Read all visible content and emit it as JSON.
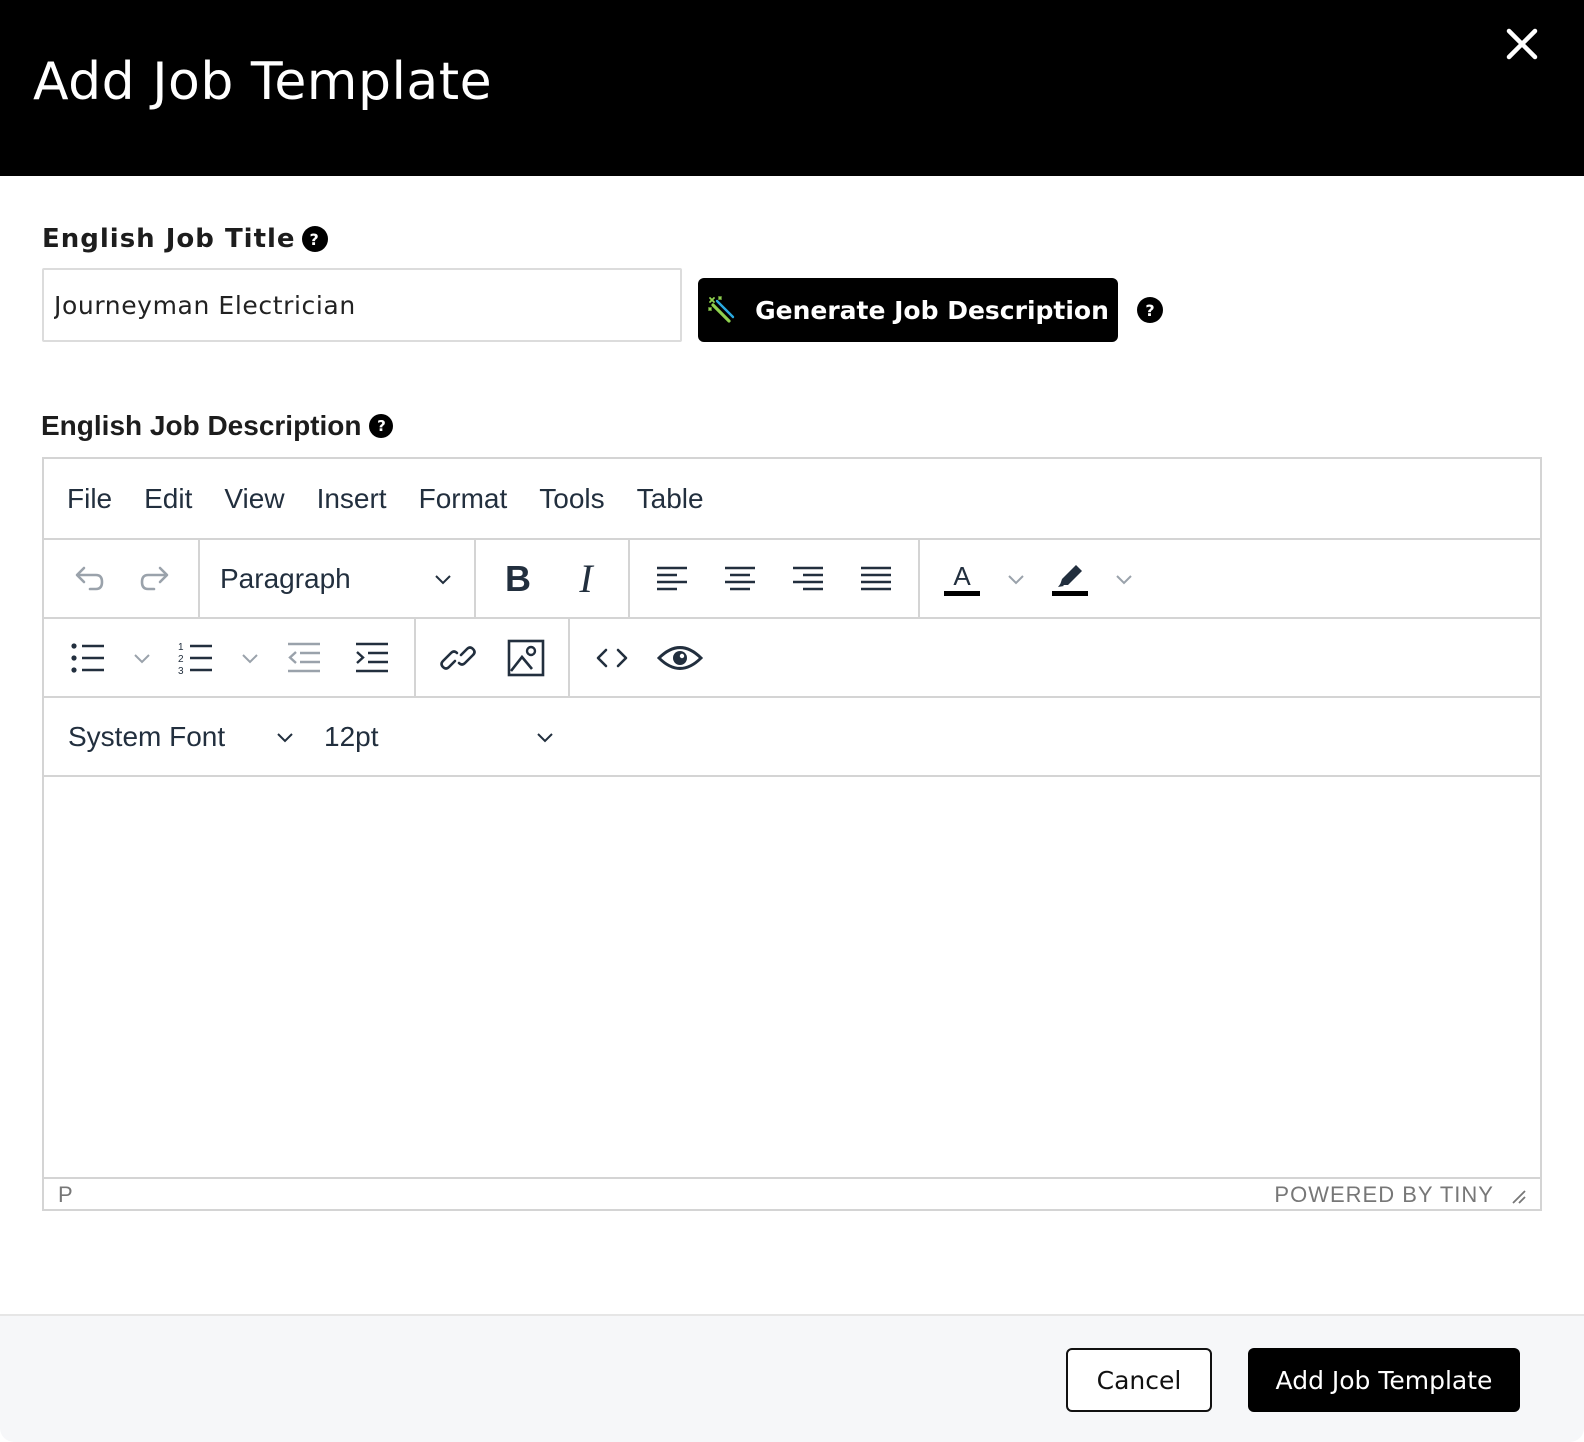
{
  "dialog": {
    "title": "Add Job Template",
    "close_icon": "close-icon"
  },
  "job_title": {
    "label": "English Job Title",
    "help_icon": "help-icon",
    "value": "Journeyman Electrician"
  },
  "generate": {
    "label": "Generate Job Description",
    "icon": "magic-wand-icon",
    "help_icon": "help-icon"
  },
  "job_description": {
    "label": "English Job Description",
    "help_icon": "help-icon"
  },
  "editor": {
    "menu": [
      "File",
      "Edit",
      "View",
      "Insert",
      "Format",
      "Tools",
      "Table"
    ],
    "block_format": "Paragraph",
    "font_family": "System Font",
    "font_size": "12pt",
    "status_path": "P",
    "branding": "POWERED BY TINY",
    "toolbar_icons": {
      "undo": "undo-icon",
      "redo": "redo-icon",
      "bold": "bold-icon",
      "italic": "italic-icon",
      "align_left": "align-left-icon",
      "align_center": "align-center-icon",
      "align_right": "align-right-icon",
      "align_justify": "align-justify-icon",
      "text_color": "text-color-icon",
      "highlight": "highlight-icon",
      "bullet_list": "bullet-list-icon",
      "numbered_list": "numbered-list-icon",
      "outdent": "outdent-icon",
      "indent": "indent-icon",
      "link": "link-icon",
      "image": "image-icon",
      "code": "source-code-icon",
      "preview": "preview-eye-icon"
    }
  },
  "footer": {
    "cancel_label": "Cancel",
    "submit_label": "Add Job Template"
  },
  "colors": {
    "header_bg": "#000000",
    "primary_button": "#000000",
    "footer_bg": "#f6f7f9",
    "editor_border": "#d4d4d4",
    "toolbar_text": "#222f3e"
  }
}
